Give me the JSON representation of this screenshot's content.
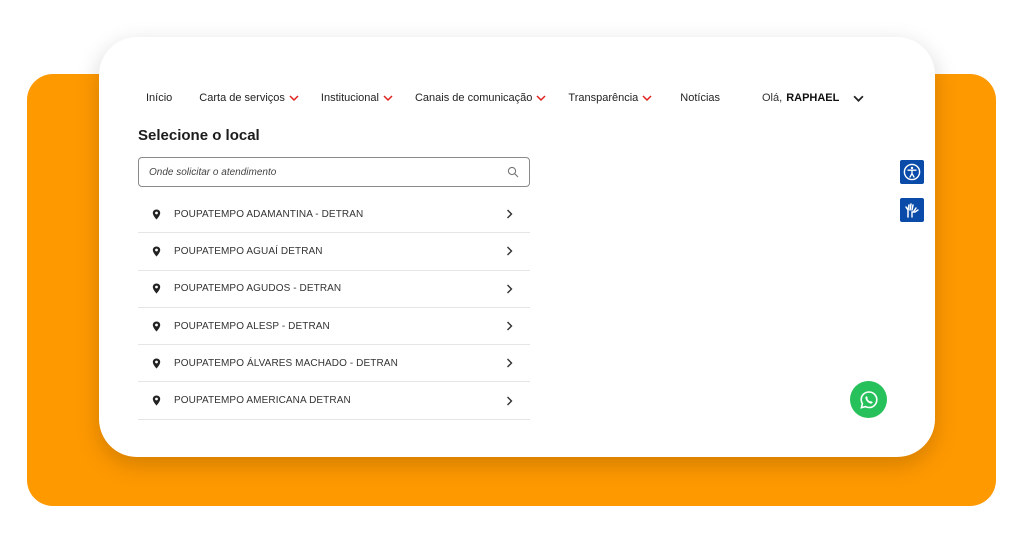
{
  "nav": {
    "items": [
      {
        "label": "Início",
        "has_dropdown": false
      },
      {
        "label": "Carta de serviços",
        "has_dropdown": true
      },
      {
        "label": "Institucional",
        "has_dropdown": true
      },
      {
        "label": "Canais de comunicação",
        "has_dropdown": true
      },
      {
        "label": "Transparência",
        "has_dropdown": true
      },
      {
        "label": "Notícias",
        "has_dropdown": false
      }
    ],
    "dropdown_color": "#e0201b",
    "user": {
      "greeting": "Olá,",
      "name": "RAPHAEL"
    }
  },
  "page": {
    "title": "Selecione o local"
  },
  "search": {
    "placeholder": "Onde solicitar o atendimento"
  },
  "locations": [
    {
      "label": "POUPATEMPO ADAMANTINA - DETRAN"
    },
    {
      "label": "POUPATEMPO AGUAÍ DETRAN"
    },
    {
      "label": "POUPATEMPO AGUDOS - DETRAN"
    },
    {
      "label": "POUPATEMPO ALESP - DETRAN"
    },
    {
      "label": "POUPATEMPO ÁLVARES MACHADO - DETRAN"
    },
    {
      "label": "POUPATEMPO AMERICANA DETRAN"
    }
  ],
  "colors": {
    "background_accent": "#FF9900",
    "accessibility": "#0a4aa8",
    "whatsapp": "#27c15b"
  },
  "icons": {
    "accessibility": "accessibility-icon",
    "sign_language": "sign-language-icon",
    "whatsapp": "whatsapp-icon"
  }
}
